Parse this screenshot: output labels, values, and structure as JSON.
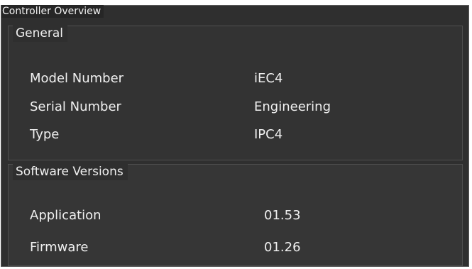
{
  "window": {
    "title": "Controller Overview"
  },
  "general": {
    "title": "General",
    "rows": [
      {
        "label": "Model Number",
        "value": "iEC4"
      },
      {
        "label": "Serial Number",
        "value": "Engineering"
      },
      {
        "label": "Type",
        "value": "IPC4"
      }
    ]
  },
  "software_versions": {
    "title": "Software Versions",
    "rows": [
      {
        "label": "Application",
        "value": "01.53"
      },
      {
        "label": "Firmware",
        "value": "01.26"
      }
    ]
  },
  "colors": {
    "panel_background": "#2f2f2f",
    "group_background": "#333333",
    "text": "#f0f0f0",
    "border": "#5c5c5c"
  }
}
